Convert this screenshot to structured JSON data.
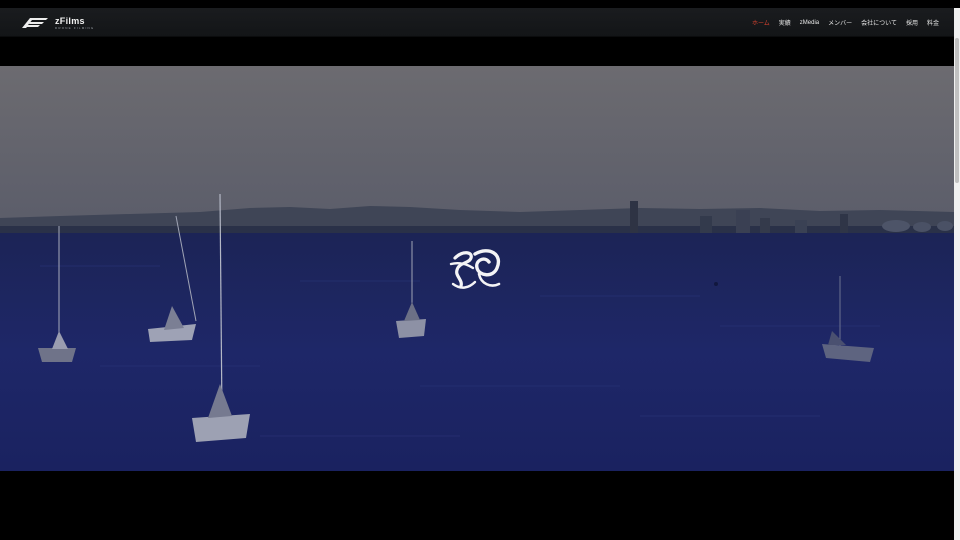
{
  "brand": {
    "name": "zFilms",
    "tagline": "DRONE FILMING"
  },
  "nav": {
    "items": [
      {
        "label": "ホーム",
        "active": true
      },
      {
        "label": "実績",
        "active": false
      },
      {
        "label": "zMedia",
        "active": false
      },
      {
        "label": "メンバー",
        "active": false
      },
      {
        "label": "会社について",
        "active": false
      },
      {
        "label": "採用",
        "active": false
      },
      {
        "label": "料金",
        "active": false
      }
    ]
  },
  "colors": {
    "nav_bg": "#16181b",
    "active_menu": "#d2422f",
    "sky": "#6f6e73",
    "water": "#1d2764"
  },
  "icons": {
    "logo": "zfilms-logo-icon",
    "center": "brush-calligraphy-logo-icon"
  }
}
